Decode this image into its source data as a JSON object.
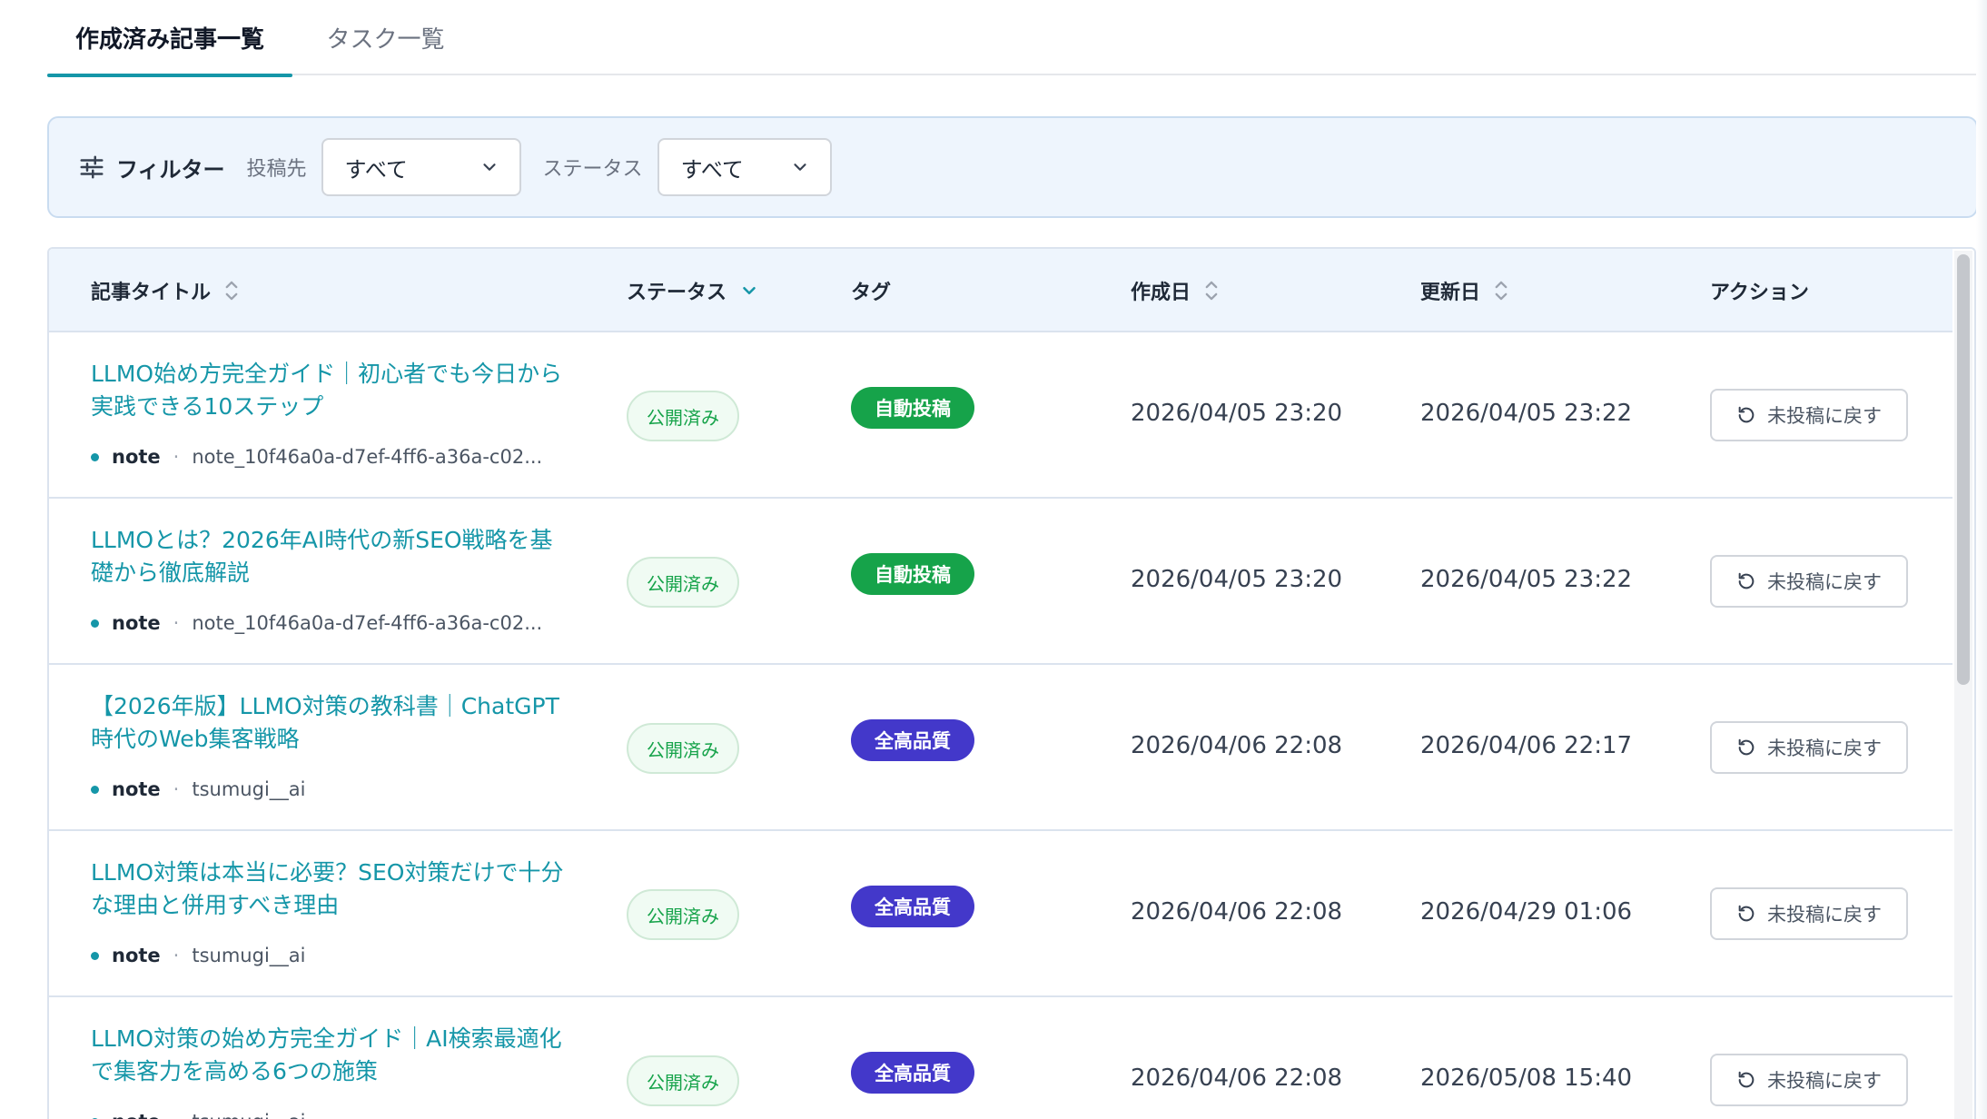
{
  "tabs": [
    {
      "label": "作成済み記事一覧",
      "active": true
    },
    {
      "label": "タスク一覧",
      "active": false
    }
  ],
  "filter": {
    "title": "フィルター",
    "destination_label": "投稿先",
    "destination_value": "すべて",
    "status_label": "ステータス",
    "status_value": "すべて"
  },
  "table": {
    "columns": {
      "title": "記事タイトル",
      "status": "ステータス",
      "tag": "タグ",
      "created": "作成日",
      "updated": "更新日",
      "action": "アクション"
    },
    "rows": [
      {
        "title": "LLMO始め方完全ガイド｜初心者でも今日から実践できる10ステップ",
        "platform": "note",
        "sep": "·",
        "account": "note_10f46a0a-d7ef-4ff6-a36a-c02...",
        "status": "公開済み",
        "tag": "自動投稿",
        "tag_color": "#16a34a",
        "created": "2026/04/05 23:20",
        "updated": "2026/04/05 23:22",
        "action": "未投稿に戻す"
      },
      {
        "title": "LLMOとは？2026年AI時代の新SEO戦略を基礎から徹底解説",
        "platform": "note",
        "sep": "·",
        "account": "note_10f46a0a-d7ef-4ff6-a36a-c02...",
        "status": "公開済み",
        "tag": "自動投稿",
        "tag_color": "#16a34a",
        "created": "2026/04/05 23:20",
        "updated": "2026/04/05 23:22",
        "action": "未投稿に戻す"
      },
      {
        "title": "【2026年版】LLMO対策の教科書｜ChatGPT時代のWeb集客戦略",
        "platform": "note",
        "sep": "·",
        "account": "tsumugi__ai",
        "status": "公開済み",
        "tag": "全高品質",
        "tag_color": "#4338ca",
        "created": "2026/04/06 22:08",
        "updated": "2026/04/06 22:17",
        "action": "未投稿に戻す"
      },
      {
        "title": "LLMO対策は本当に必要？SEO対策だけで十分な理由と併用すべき理由",
        "platform": "note",
        "sep": "·",
        "account": "tsumugi__ai",
        "status": "公開済み",
        "tag": "全高品質",
        "tag_color": "#4338ca",
        "created": "2026/04/06 22:08",
        "updated": "2026/04/29 01:06",
        "action": "未投稿に戻す"
      },
      {
        "title": "LLMO対策の始め方完全ガイド｜AI検索最適化で集客力を高める6つの施策",
        "platform": "note",
        "sep": "·",
        "account": "tsumugi__ai",
        "status": "公開済み",
        "tag": "全高品質",
        "tag_color": "#4338ca",
        "created": "2026/04/06 22:08",
        "updated": "2026/05/08 15:40",
        "action": "未投稿に戻す"
      }
    ]
  },
  "colors": {
    "accent": "#1596a8",
    "status_green": "#16a34a",
    "tag_green": "#16a34a",
    "tag_indigo": "#4338ca"
  },
  "icons": {
    "filter": "sliders-icon",
    "dropdown": "chevron-down-icon",
    "sort": "sort-icon",
    "undo": "undo-icon"
  }
}
